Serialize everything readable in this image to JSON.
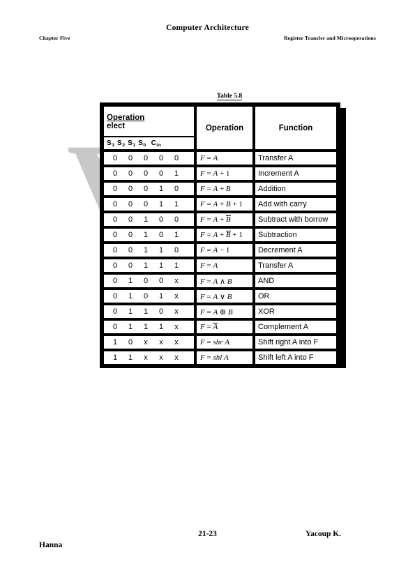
{
  "page": {
    "header": {
      "title": "Computer Architecture",
      "left": "Chapter Five",
      "right": "Register Transfer and Microoperations"
    },
    "watermark": {
      "text": "VCI",
      "color": "#c8c8c8"
    },
    "footer": {
      "page_number": "21-23",
      "author_first": "Yacoup K.",
      "author_last": "Hanna"
    }
  },
  "table": {
    "caption": "Table 5.8",
    "header": {
      "select_title_line1": "Operation",
      "select_title_line2": "elect",
      "bits": [
        "S",
        "3",
        "S",
        "2",
        "S",
        "1",
        "S",
        "0",
        "C",
        "in"
      ],
      "bits_label": "S3 S2 S1 S0 Cin",
      "operation": "Operation",
      "function": "Function"
    },
    "columns": [
      "Operation select",
      "Operation",
      "Function"
    ],
    "bit_columns": [
      "S3",
      "S2",
      "S1",
      "S0",
      "Cin"
    ],
    "rows": [
      {
        "s3": "0",
        "s2": "0",
        "s1": "0",
        "s0": "0",
        "cin": "0",
        "operation": "F = A",
        "op_parts": [
          "F",
          "=",
          "A"
        ],
        "function": "Transfer A"
      },
      {
        "s3": "0",
        "s2": "0",
        "s1": "0",
        "s0": "0",
        "cin": "1",
        "operation": "F = A + 1",
        "op_parts": [
          "F",
          "=",
          "A",
          "+1"
        ],
        "function": "Increment A"
      },
      {
        "s3": "0",
        "s2": "0",
        "s1": "0",
        "s0": "1",
        "cin": "0",
        "operation": "F = A + B",
        "op_parts": [
          "F",
          "=",
          "A",
          "+",
          "B"
        ],
        "function": "Addition"
      },
      {
        "s3": "0",
        "s2": "0",
        "s1": "0",
        "s0": "1",
        "cin": "1",
        "operation": "F = A + B + 1",
        "op_parts": [
          "F",
          "=",
          "A",
          "+",
          "B",
          "+1"
        ],
        "function": "Add with carry"
      },
      {
        "s3": "0",
        "s2": "0",
        "s1": "1",
        "s0": "0",
        "cin": "0",
        "operation": "F = A + B̅",
        "op_parts": [
          "F",
          "=",
          "A",
          "+",
          "B̅"
        ],
        "function": "Subtract with borrow"
      },
      {
        "s3": "0",
        "s2": "0",
        "s1": "1",
        "s0": "0",
        "cin": "1",
        "operation": "F = A + B̅ + 1",
        "op_parts": [
          "F",
          "=",
          "A",
          "+",
          "B̅",
          "+1"
        ],
        "function": "Subtraction"
      },
      {
        "s3": "0",
        "s2": "0",
        "s1": "1",
        "s0": "1",
        "cin": "0",
        "operation": "F = A − 1",
        "op_parts": [
          "F",
          "=",
          "A",
          "−1"
        ],
        "function": "Decrement A"
      },
      {
        "s3": "0",
        "s2": "0",
        "s1": "1",
        "s0": "1",
        "cin": "1",
        "operation": "F = A",
        "op_parts": [
          "F",
          "=",
          "A"
        ],
        "function": "Transfer A"
      },
      {
        "s3": "0",
        "s2": "1",
        "s1": "0",
        "s0": "0",
        "cin": "x",
        "operation": "F = A ∧ B",
        "op_parts": [
          "F",
          "=",
          "A",
          "∧",
          "B"
        ],
        "function": "AND"
      },
      {
        "s3": "0",
        "s2": "1",
        "s1": "0",
        "s0": "1",
        "cin": "x",
        "operation": "F = A ∨ B",
        "op_parts": [
          "F",
          "=",
          "A",
          "∨",
          "B"
        ],
        "function": "OR"
      },
      {
        "s3": "0",
        "s2": "1",
        "s1": "1",
        "s0": "0",
        "cin": "x",
        "operation": "F = A ⊕ B",
        "op_parts": [
          "F",
          "=",
          "A",
          "⊕",
          "B"
        ],
        "function": "XOR"
      },
      {
        "s3": "0",
        "s2": "1",
        "s1": "1",
        "s0": "1",
        "cin": "x",
        "operation": "F = A̅",
        "op_parts": [
          "F",
          "=",
          "A̅"
        ],
        "function": "Complement A"
      },
      {
        "s3": "1",
        "s2": "0",
        "s1": "x",
        "s0": "x",
        "cin": "x",
        "operation": "F = shr A",
        "op_parts": [
          "F",
          "=",
          "shr",
          "A"
        ],
        "function": "Shift right A into F"
      },
      {
        "s3": "1",
        "s2": "1",
        "s1": "x",
        "s0": "x",
        "cin": "x",
        "operation": "F = shl A",
        "op_parts": [
          "F",
          "=",
          "shl",
          "A"
        ],
        "function": "Shift left A into F"
      }
    ]
  }
}
